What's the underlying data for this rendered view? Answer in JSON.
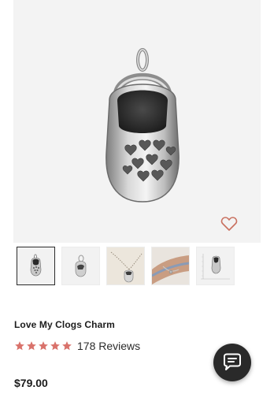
{
  "product": {
    "title": "Love My Clogs Charm",
    "rating": 5,
    "reviews_label": "178 Reviews",
    "price": "$79.00"
  },
  "colors": {
    "star": "#d9726b",
    "wishlist": "#c9705f",
    "chat_bg": "#2a2a2a"
  },
  "icons": {
    "wishlist": "heart-outline-icon",
    "chat": "chat-bubble-icon",
    "star": "star-icon"
  },
  "gallery": {
    "thumbnails": [
      {
        "name": "thumb-charm-front",
        "active": true
      },
      {
        "name": "thumb-charm-side",
        "active": false
      },
      {
        "name": "thumb-charm-on-chain",
        "active": false
      },
      {
        "name": "thumb-charm-on-wrist",
        "active": false
      },
      {
        "name": "thumb-charm-with-scale",
        "active": false
      }
    ]
  }
}
